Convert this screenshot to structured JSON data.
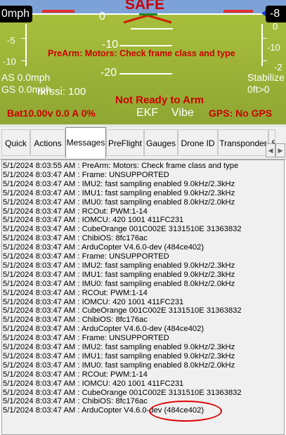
{
  "hud": {
    "speed_box": "0mph",
    "alt_box": "-8",
    "status_top": "SAFE",
    "heading_center": "0",
    "pitch_labels": [
      "-10",
      "-20"
    ],
    "left_scale": [
      "-5",
      "-10"
    ],
    "right_scale": [
      "0",
      "-10",
      "-2"
    ],
    "prearm_message": "PreArm: Motors: Check frame class and type",
    "airspeed": "AS 0.0mph",
    "groundspeed": "GS 0.0mph",
    "rxrssi": "rxrssi: 100",
    "flight_mode": "Stabilize",
    "altitude_readout": "0ft>0",
    "not_ready": "Not Ready to Arm",
    "battery": "Bat10.00v 0.0 A 0%",
    "ekf": "EKF",
    "vibe": "Vibe",
    "gps": "GPS: No GPS",
    "colors": {
      "ground": "#9db33a",
      "sky": "#7ca2d8",
      "warning": "#cc0000"
    }
  },
  "tabs": [
    "Quick",
    "Actions",
    "Messages",
    "PreFlight",
    "Gauges",
    "Drone ID",
    "Transponder",
    "S"
  ],
  "active_tab": "Messages",
  "messages": [
    "5/1/2024 8:03:55 AM : PreArm: Motors: Check frame class and type",
    "5/1/2024 8:03:47 AM : Frame: UNSUPPORTED",
    "5/1/2024 8:03:47 AM : IMU2: fast sampling enabled 9.0kHz/2.3kHz",
    "5/1/2024 8:03:47 AM : IMU1: fast sampling enabled 9.0kHz/2.3kHz",
    "5/1/2024 8:03:47 AM : IMU0: fast sampling enabled 8.0kHz/2.0kHz",
    "5/1/2024 8:03:47 AM : RCOut: PWM:1-14",
    "5/1/2024 8:03:47 AM : IOMCU: 420 1001 411FC231",
    "5/1/2024 8:03:47 AM : CubeOrange 001C002E 3131510E 31363832",
    "5/1/2024 8:03:47 AM : ChibiOS: 8fc176ac",
    "5/1/2024 8:03:47 AM : ArduCopter V4.6.0-dev (484ce402)",
    "5/1/2024 8:03:47 AM : Frame: UNSUPPORTED",
    "5/1/2024 8:03:47 AM : IMU2: fast sampling enabled 9.0kHz/2.3kHz",
    "5/1/2024 8:03:47 AM : IMU1: fast sampling enabled 9.0kHz/2.3kHz",
    "5/1/2024 8:03:47 AM : IMU0: fast sampling enabled 8.0kHz/2.0kHz",
    "5/1/2024 8:03:47 AM : RCOut: PWM:1-14",
    "5/1/2024 8:03:47 AM : IOMCU: 420 1001 411FC231",
    "5/1/2024 8:03:47 AM : CubeOrange 001C002E 3131510E 31363832",
    "5/1/2024 8:03:47 AM : ChibiOS: 8fc176ac",
    "5/1/2024 8:03:47 AM : ArduCopter V4.6.0-dev (484ce402)",
    "5/1/2024 8:03:47 AM : Frame: UNSUPPORTED",
    "5/1/2024 8:03:47 AM : IMU2: fast sampling enabled 9.0kHz/2.3kHz",
    "5/1/2024 8:03:47 AM : IMU1: fast sampling enabled 9.0kHz/2.3kHz",
    "5/1/2024 8:03:47 AM : IMU0: fast sampling enabled 8.0kHz/2.0kHz",
    "5/1/2024 8:03:47 AM : RCOut: PWM:1-14",
    "5/1/2024 8:03:47 AM : IOMCU: 420 1001 411FC231",
    "5/1/2024 8:03:47 AM : CubeOrange 001C002E 3131510E 31363832",
    "5/1/2024 8:03:47 AM : ChibiOS: 8fc176ac",
    "5/1/2024 8:03:47 AM : ArduCopter V4.6.0-dev (484ce402)"
  ]
}
